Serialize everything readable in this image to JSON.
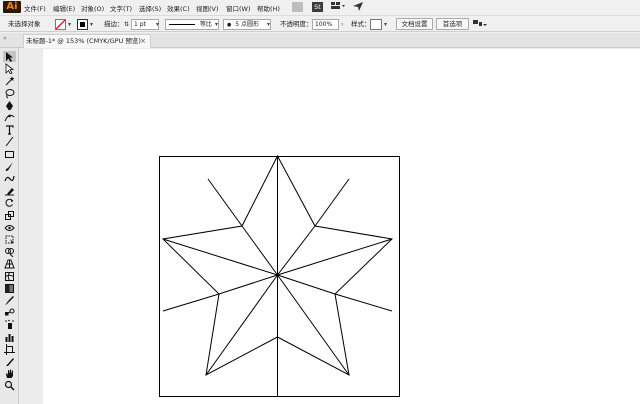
{
  "app": {
    "logo": "Ai"
  },
  "menu": [
    {
      "label": "文件(F)"
    },
    {
      "label": "编辑(E)"
    },
    {
      "label": "对象(O)"
    },
    {
      "label": "文字(T)"
    },
    {
      "label": "选择(S)"
    },
    {
      "label": "效果(C)"
    },
    {
      "label": "视图(V)"
    },
    {
      "label": "窗口(W)"
    },
    {
      "label": "帮助(H)"
    }
  ],
  "menubar_buttons": {
    "stock": "St"
  },
  "controlbar": {
    "no_selection": "未选择对象",
    "stroke_label": "描边：",
    "stroke_value": "1 pt",
    "stroke_profile": "等比",
    "brush": "5 点圆形",
    "opacity_label": "不透明度：",
    "opacity_value": "100%",
    "style_label": "样式：",
    "doc_setup": "文档设置",
    "preferences": "首选项"
  },
  "tab": {
    "title": "未标题-1* @ 153% (CMYK/GPU 预览)",
    "close": "×",
    "collapse": "«"
  },
  "tools": [
    "selection-tool",
    "direct-selection-tool",
    "magic-wand-tool",
    "lasso-tool",
    "pen-tool",
    "curvature-tool",
    "type-tool",
    "line-tool",
    "rectangle-tool",
    "paintbrush-tool",
    "shaper-tool",
    "eraser-tool",
    "rotate-tool",
    "scale-tool",
    "width-tool",
    "free-transform-tool",
    "shape-builder-tool",
    "perspective-grid-tool",
    "mesh-tool",
    "gradient-tool",
    "eyedropper-tool",
    "blend-tool",
    "symbol-sprayer-tool",
    "column-graph-tool",
    "artboard-tool",
    "slice-tool",
    "hand-tool",
    "zoom-tool"
  ],
  "colors": {
    "accent_logo": "#ff7c00",
    "artboard": "#ffffff",
    "stroke": "#000000"
  }
}
